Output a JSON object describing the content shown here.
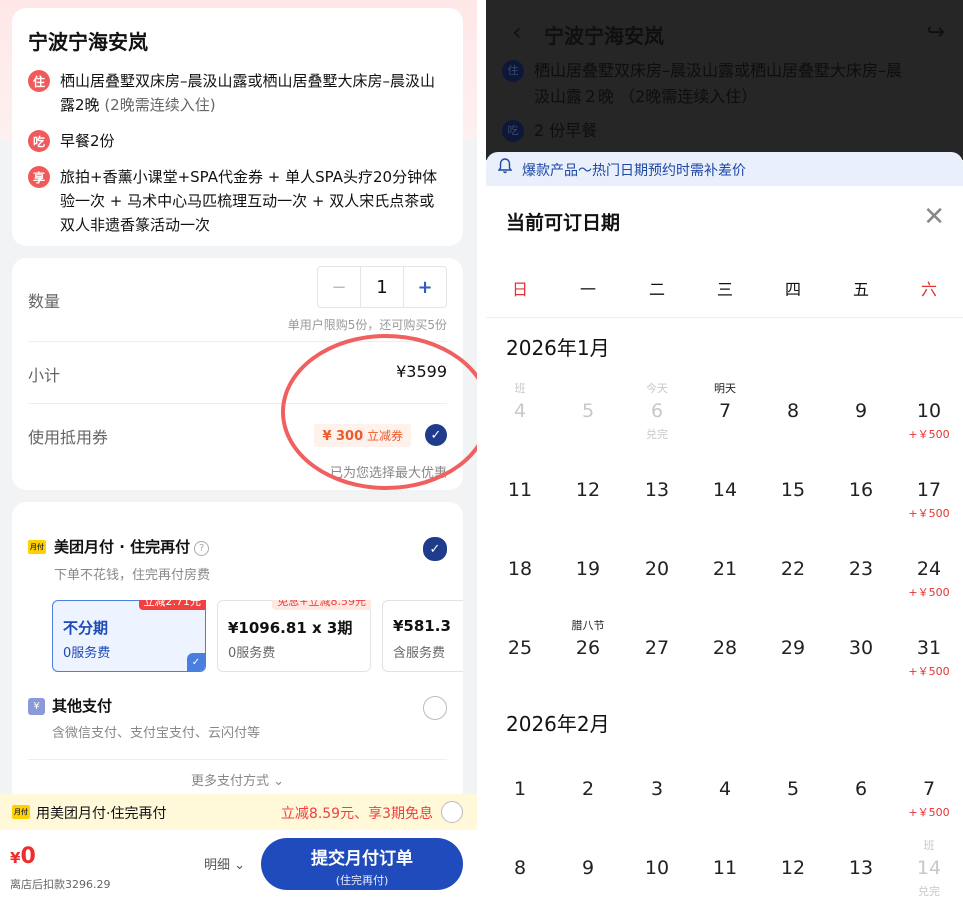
{
  "left": {
    "hotel_title": "宁波宁海安岚",
    "info": [
      {
        "tag": "住",
        "text": "栖山居叠墅双床房–晨汲山露或栖山居叠墅大床房–晨汲山露2晚",
        "muted": "(2晚需连续入住)"
      },
      {
        "tag": "吃",
        "text": "早餐2份",
        "muted": ""
      },
      {
        "tag": "享",
        "text": "旅拍+香薰小课堂+SPA代金券 + 单人SPA头疗20分钟体验一次 + 马术中心马匹梳理互动一次 + 双人宋氏点茶或双人非遗香篆活动一次",
        "muted": ""
      }
    ],
    "quantity": {
      "label": "数量",
      "minus": "−",
      "value": "1",
      "plus": "+",
      "limit_note": "单用户限购5份，还可购买5份"
    },
    "subtotal": {
      "label": "小计",
      "value": "¥3599"
    },
    "coupon": {
      "label": "使用抵用券",
      "badge_amount": "¥ 300",
      "badge_text": "立减券",
      "check": "✓",
      "note": "已为您选择最大优惠"
    },
    "monthly_pay": {
      "logo": "月付",
      "title": "美团月付 · 住完再付",
      "help": "?",
      "subtitle": "下单不花钱，住完再付房费",
      "check": "✓"
    },
    "plans": [
      {
        "tag": "立减2.71元",
        "line1": "不分期",
        "line2": "0服务费",
        "selected": true
      },
      {
        "tag": "免息+立减8.59元",
        "line1": "¥1096.81 x 3期",
        "line2": "0服务费",
        "selected": false
      },
      {
        "tag": "",
        "line1": "¥581.3",
        "line2": "含服务费",
        "selected": false
      }
    ],
    "other_pay": {
      "icon": "¥",
      "title": "其他支付",
      "subtitle": "含微信支付、支付宝支付、云闪付等"
    },
    "more_pay": "更多支付方式 ⌄",
    "promo": {
      "logo": "月付",
      "text": "用美团月付·住完再付",
      "right": "立减8.59元、享3期免息"
    },
    "bottom": {
      "currency": "¥",
      "amount": "0",
      "note": "离店后扣款3296.29",
      "detail": "明细 ⌄",
      "submit": "提交月付订单",
      "submit_sub": "(住完再付)"
    }
  },
  "right": {
    "header": {
      "back": "‹",
      "title": "宁波宁海安岚",
      "share": "↪"
    },
    "bg_rows": [
      {
        "tag": "住",
        "text": "栖山居叠墅双床房–晨汲山露或栖山居叠墅大床房–晨"
      },
      {
        "tag": "",
        "text": "汲山露２晚 （2晚需连续入住）"
      },
      {
        "tag": "吃",
        "text": "2 份早餐"
      }
    ],
    "notice": {
      "icon": "🔔",
      "text": "爆款产品～热门日期预约时需补差价"
    },
    "sheet_title": "当前可订日期",
    "close": "✕",
    "weekdays": [
      "日",
      "一",
      "二",
      "三",
      "四",
      "五",
      "六"
    ],
    "months": [
      {
        "title": "2026年1月",
        "weeks": [
          [
            {
              "num": "4",
              "top": "班",
              "bot": "",
              "disabled": true
            },
            {
              "num": "5",
              "top": "",
              "bot": "",
              "disabled": true
            },
            {
              "num": "6",
              "top": "今天",
              "bot": "兑完",
              "disabled": true
            },
            {
              "num": "7",
              "top": "明天",
              "bot": "",
              "disabled": false
            },
            {
              "num": "8",
              "top": "",
              "bot": "",
              "disabled": false
            },
            {
              "num": "9",
              "top": "",
              "bot": "",
              "disabled": false
            },
            {
              "num": "10",
              "top": "",
              "bot": "+￥500",
              "disabled": false
            }
          ],
          [
            {
              "num": "11",
              "top": "",
              "bot": "",
              "disabled": false
            },
            {
              "num": "12",
              "top": "",
              "bot": "",
              "disabled": false
            },
            {
              "num": "13",
              "top": "",
              "bot": "",
              "disabled": false
            },
            {
              "num": "14",
              "top": "",
              "bot": "",
              "disabled": false
            },
            {
              "num": "15",
              "top": "",
              "bot": "",
              "disabled": false
            },
            {
              "num": "16",
              "top": "",
              "bot": "",
              "disabled": false
            },
            {
              "num": "17",
              "top": "",
              "bot": "+￥500",
              "disabled": false
            }
          ],
          [
            {
              "num": "18",
              "top": "",
              "bot": "",
              "disabled": false
            },
            {
              "num": "19",
              "top": "",
              "bot": "",
              "disabled": false
            },
            {
              "num": "20",
              "top": "",
              "bot": "",
              "disabled": false
            },
            {
              "num": "21",
              "top": "",
              "bot": "",
              "disabled": false
            },
            {
              "num": "22",
              "top": "",
              "bot": "",
              "disabled": false
            },
            {
              "num": "23",
              "top": "",
              "bot": "",
              "disabled": false
            },
            {
              "num": "24",
              "top": "",
              "bot": "+￥500",
              "disabled": false
            }
          ],
          [
            {
              "num": "25",
              "top": "",
              "bot": "",
              "disabled": false
            },
            {
              "num": "26",
              "top": "腊八节",
              "bot": "",
              "disabled": false
            },
            {
              "num": "27",
              "top": "",
              "bot": "",
              "disabled": false
            },
            {
              "num": "28",
              "top": "",
              "bot": "",
              "disabled": false
            },
            {
              "num": "29",
              "top": "",
              "bot": "",
              "disabled": false
            },
            {
              "num": "30",
              "top": "",
              "bot": "",
              "disabled": false
            },
            {
              "num": "31",
              "top": "",
              "bot": "+￥500",
              "disabled": false
            }
          ]
        ]
      },
      {
        "title": "2026年2月",
        "weeks": [
          [
            {
              "num": "1",
              "top": "",
              "bot": "",
              "disabled": false
            },
            {
              "num": "2",
              "top": "",
              "bot": "",
              "disabled": false
            },
            {
              "num": "3",
              "top": "",
              "bot": "",
              "disabled": false
            },
            {
              "num": "4",
              "top": "",
              "bot": "",
              "disabled": false
            },
            {
              "num": "5",
              "top": "",
              "bot": "",
              "disabled": false
            },
            {
              "num": "6",
              "top": "",
              "bot": "",
              "disabled": false
            },
            {
              "num": "7",
              "top": "",
              "bot": "+￥500",
              "disabled": false
            }
          ],
          [
            {
              "num": "8",
              "top": "",
              "bot": "",
              "disabled": false
            },
            {
              "num": "9",
              "top": "",
              "bot": "",
              "disabled": false
            },
            {
              "num": "10",
              "top": "",
              "bot": "",
              "disabled": false
            },
            {
              "num": "11",
              "top": "",
              "bot": "",
              "disabled": false
            },
            {
              "num": "12",
              "top": "",
              "bot": "",
              "disabled": false
            },
            {
              "num": "13",
              "top": "",
              "bot": "",
              "disabled": false
            },
            {
              "num": "14",
              "top": "班",
              "bot": "兑完",
              "disabled": true
            }
          ]
        ]
      }
    ]
  },
  "colors": {
    "brand_blue": "#1f4bbd",
    "accent_red": "#e53333",
    "highlight_ring": "#f06060"
  }
}
